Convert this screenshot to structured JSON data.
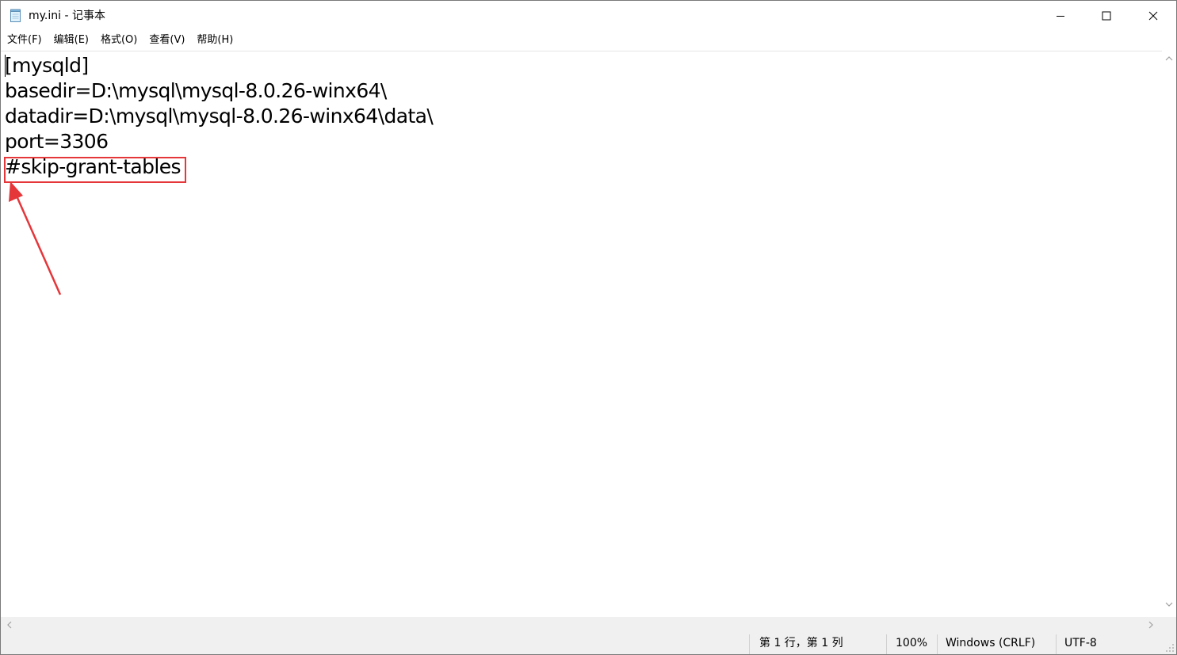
{
  "window": {
    "title": "my.ini - 记事本",
    "icon": "notepad-icon",
    "controls": {
      "minimize_icon": "minimize-icon",
      "maximize_icon": "maximize-icon",
      "close_icon": "close-icon"
    }
  },
  "menu": {
    "items": [
      {
        "label": "文件(F)"
      },
      {
        "label": "编辑(E)"
      },
      {
        "label": "格式(O)"
      },
      {
        "label": "查看(V)"
      },
      {
        "label": "帮助(H)"
      }
    ]
  },
  "editor": {
    "lines": [
      "[mysqld]",
      "basedir=D:\\mysql\\mysql-8.0.26-winx64\\",
      "datadir=D:\\mysql\\mysql-8.0.26-winx64\\data\\",
      "port=3306",
      "#skip-grant-tables"
    ],
    "annotation": {
      "highlighted_line": "#skip-grant-tables",
      "color": "#e5363a"
    }
  },
  "statusbar": {
    "position": "第 1 行，第 1 列",
    "zoom": "100%",
    "line_ending": "Windows (CRLF)",
    "encoding": "UTF-8"
  }
}
